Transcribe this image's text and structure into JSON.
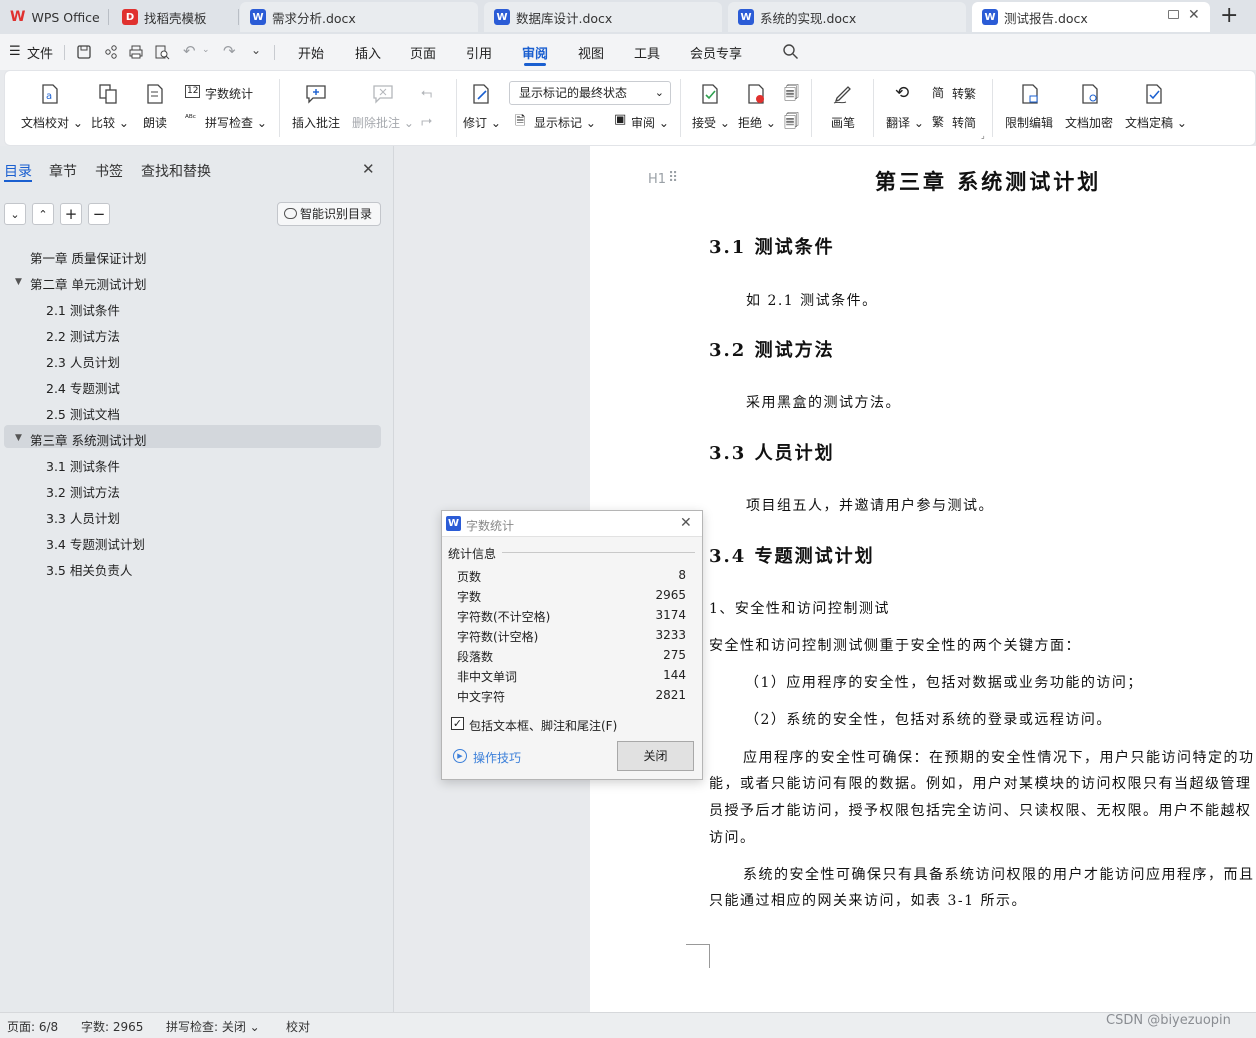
{
  "tabs": [
    {
      "label": "WPS Office",
      "icon": "wps-logo-icon",
      "active": false
    },
    {
      "label": "找稻壳模板",
      "icon": "docer-icon",
      "active": false
    },
    {
      "label": "需求分析.docx",
      "icon": "word-doc-icon",
      "active": false
    },
    {
      "label": "数据库设计.docx",
      "icon": "word-doc-icon",
      "active": false
    },
    {
      "label": "系统的实现.docx",
      "icon": "word-doc-icon",
      "active": false
    },
    {
      "label": "测试报告.docx",
      "icon": "word-doc-icon",
      "active": true
    }
  ],
  "menubar": {
    "file_label": "文件",
    "items": [
      "开始",
      "插入",
      "页面",
      "引用",
      "审阅",
      "视图",
      "工具",
      "会员专享"
    ],
    "active": "审阅"
  },
  "ribbon": {
    "doc_proofread": "文档校对",
    "compare": "比较",
    "read_aloud": "朗读",
    "word_count": "字数统计",
    "spell_check": "拼写检查",
    "insert_comment": "插入批注",
    "delete_comment": "删除批注",
    "track_changes": "修订",
    "markup_select": "显示标记的最终状态",
    "show_markup": "显示标记",
    "review": "审阅",
    "accept": "接受",
    "reject": "拒绝",
    "pen": "画笔",
    "translate": "翻译",
    "to_traditional": "转繁",
    "to_simplified": "转简",
    "restrict_edit": "限制编辑",
    "encrypt": "文档加密",
    "finalize": "文档定稿"
  },
  "sidebar": {
    "tabs": [
      "目录",
      "章节",
      "书签",
      "查找和替换"
    ],
    "active_tab": "目录",
    "smart_toc": "智能识别目录",
    "toc": [
      {
        "label": "第一章  质量保证计划",
        "level": 1,
        "expanded": false,
        "selected": false
      },
      {
        "label": "第二章  单元测试计划",
        "level": 1,
        "expanded": true,
        "selected": false
      },
      {
        "label": "2.1  测试条件",
        "level": 2
      },
      {
        "label": "2.2  测试方法",
        "level": 2
      },
      {
        "label": "2.3  人员计划",
        "level": 2
      },
      {
        "label": "2.4  专题测试",
        "level": 2
      },
      {
        "label": "2.5  测试文档",
        "level": 2
      },
      {
        "label": "第三章  系统测试计划",
        "level": 1,
        "expanded": true,
        "selected": true
      },
      {
        "label": "3.1  测试条件",
        "level": 2
      },
      {
        "label": "3.2  测试方法",
        "level": 2
      },
      {
        "label": "3.3  人员计划",
        "level": 2
      },
      {
        "label": "3.4  专题测试计划",
        "level": 2
      },
      {
        "label": "3.5 相关负责人",
        "level": 2
      }
    ]
  },
  "document": {
    "heading_marker": "H1",
    "chapter_title": "第三章  系统测试计划",
    "sections": [
      {
        "num": "3.1",
        "title": "测试条件",
        "text": "如 2.1 测试条件。"
      },
      {
        "num": "3.2",
        "title": "测试方法",
        "text": "采用黑盒的测试方法。"
      },
      {
        "num": "3.3",
        "title": "人员计划",
        "text": "项目组五人，并邀请用户参与测试。"
      },
      {
        "num": "3.4",
        "title": "专题测试计划",
        "text": ""
      }
    ],
    "paragraphs": [
      "1、安全性和访问控制测试",
      "安全性和访问控制测试侧重于安全性的两个关键方面：",
      "（1）应用程序的安全性，包括对数据或业务功能的访问；",
      "（2）系统的安全性，包括对系统的登录或远程访问。",
      "应用程序的安全性可确保：在预期的安全性情况下，用户只能访问特定的功",
      "能，或者只能访问有限的数据。例如，用户对某模块的访问权限只有当超级管理",
      "员授予后才能访问，授予权限包括完全访问、只读权限、无权限。用户不能越权",
      "访问。",
      "系统的安全性可确保只有具备系统访问权限的用户才能访问应用程序，而且",
      "只能通过相应的网关来访问，如表 3-1 所示。"
    ]
  },
  "dialog": {
    "title": "字数统计",
    "section_label": "统计信息",
    "stats": [
      {
        "label": "页数",
        "value": "8"
      },
      {
        "label": "字数",
        "value": "2965"
      },
      {
        "label": "字符数(不计空格)",
        "value": "3174"
      },
      {
        "label": "字符数(计空格)",
        "value": "3233"
      },
      {
        "label": "段落数",
        "value": "275"
      },
      {
        "label": "非中文单词",
        "value": "144"
      },
      {
        "label": "中文字符",
        "value": "2821"
      }
    ],
    "checkbox_label": "包括文本框、脚注和尾注(F)",
    "checkbox_checked": true,
    "tips_label": "操作技巧",
    "close_button": "关闭"
  },
  "status": {
    "page": "页面: 6/8",
    "words": "字数: 2965",
    "spell": "拼写检查: 关闭",
    "proof": "校对",
    "watermark": "CSDN @biyezuopin"
  },
  "colors": {
    "accent": "#1a5fd0",
    "wps_red": "#e0312f",
    "word_blue": "#2b5cd6"
  }
}
